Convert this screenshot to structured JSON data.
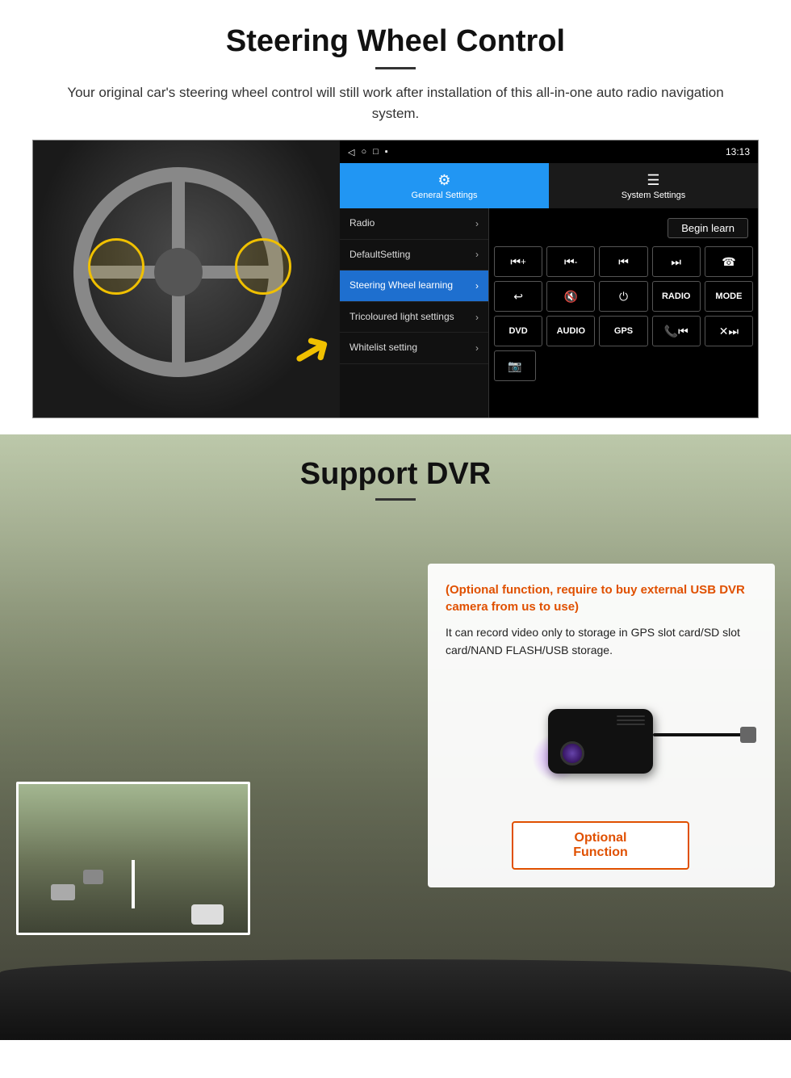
{
  "page": {
    "steering_section": {
      "title": "Steering Wheel Control",
      "description": "Your original car's steering wheel control will still work after installation of this all-in-one auto radio navigation system.",
      "android_ui": {
        "statusbar": {
          "time": "13:13",
          "icons": [
            "◁",
            "○",
            "□",
            "▪"
          ]
        },
        "tab_general": "General Settings",
        "tab_system": "System Settings",
        "menu_items": [
          {
            "label": "Radio",
            "active": false
          },
          {
            "label": "DefaultSetting",
            "active": false
          },
          {
            "label": "Steering Wheel learning",
            "active": true
          },
          {
            "label": "Tricoloured light settings",
            "active": false
          },
          {
            "label": "Whitelist setting",
            "active": false
          }
        ],
        "begin_learn_label": "Begin learn",
        "control_buttons_row1": [
          "⏮+",
          "⏮-",
          "⏮|",
          "|⏭",
          "☎"
        ],
        "control_buttons_row2": [
          "↩",
          "🔇x",
          "⏻",
          "RADIO",
          "MODE"
        ],
        "control_buttons_row3": [
          "DVD",
          "AUDIO",
          "GPS",
          "📞|⏮",
          "✖|⏭"
        ],
        "control_buttons_row4": [
          "📹"
        ]
      }
    },
    "dvr_section": {
      "title": "Support DVR",
      "optional_text": "(Optional function, require to buy external USB DVR camera from us to use)",
      "description": "It can record video only to storage in GPS slot card/SD slot card/NAND FLASH/USB storage.",
      "optional_button_label": "Optional Function"
    }
  }
}
